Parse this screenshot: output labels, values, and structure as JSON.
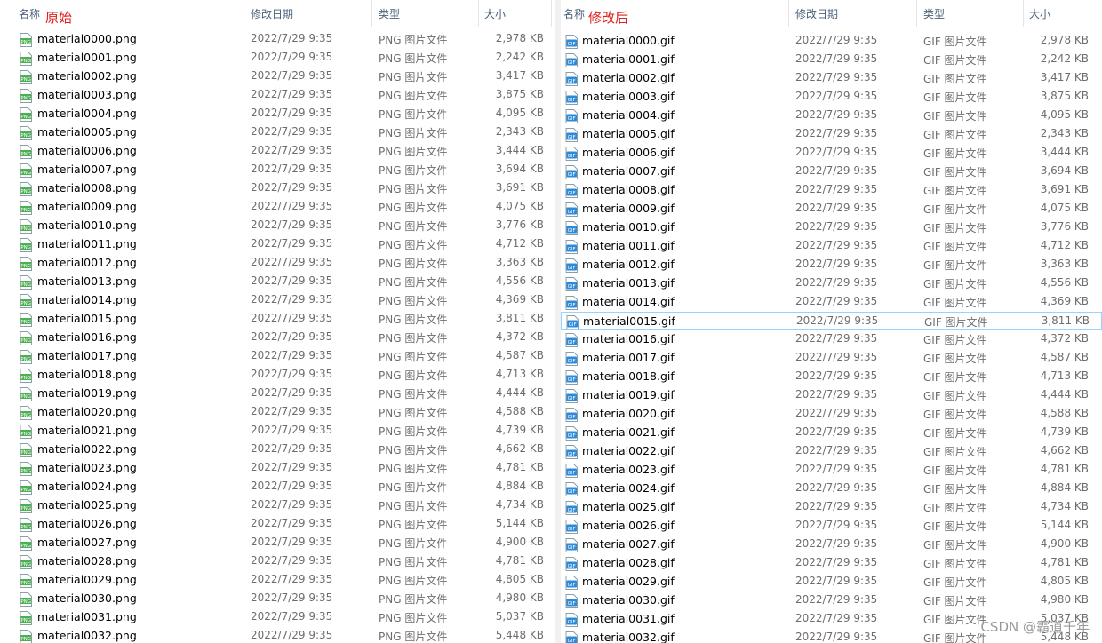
{
  "columns": {
    "name": "名称",
    "date": "修改日期",
    "type": "类型",
    "size": "大小"
  },
  "left": {
    "annotation": "原始",
    "type_label": "PNG 图片文件",
    "rows": [
      {
        "name": "material0000.png",
        "date": "2022/7/29 9:35",
        "size": "2,978 KB"
      },
      {
        "name": "material0001.png",
        "date": "2022/7/29 9:35",
        "size": "2,242 KB"
      },
      {
        "name": "material0002.png",
        "date": "2022/7/29 9:35",
        "size": "3,417 KB"
      },
      {
        "name": "material0003.png",
        "date": "2022/7/29 9:35",
        "size": "3,875 KB"
      },
      {
        "name": "material0004.png",
        "date": "2022/7/29 9:35",
        "size": "4,095 KB"
      },
      {
        "name": "material0005.png",
        "date": "2022/7/29 9:35",
        "size": "2,343 KB"
      },
      {
        "name": "material0006.png",
        "date": "2022/7/29 9:35",
        "size": "3,444 KB"
      },
      {
        "name": "material0007.png",
        "date": "2022/7/29 9:35",
        "size": "3,694 KB"
      },
      {
        "name": "material0008.png",
        "date": "2022/7/29 9:35",
        "size": "3,691 KB"
      },
      {
        "name": "material0009.png",
        "date": "2022/7/29 9:35",
        "size": "4,075 KB"
      },
      {
        "name": "material0010.png",
        "date": "2022/7/29 9:35",
        "size": "3,776 KB"
      },
      {
        "name": "material0011.png",
        "date": "2022/7/29 9:35",
        "size": "4,712 KB"
      },
      {
        "name": "material0012.png",
        "date": "2022/7/29 9:35",
        "size": "3,363 KB"
      },
      {
        "name": "material0013.png",
        "date": "2022/7/29 9:35",
        "size": "4,556 KB"
      },
      {
        "name": "material0014.png",
        "date": "2022/7/29 9:35",
        "size": "4,369 KB"
      },
      {
        "name": "material0015.png",
        "date": "2022/7/29 9:35",
        "size": "3,811 KB"
      },
      {
        "name": "material0016.png",
        "date": "2022/7/29 9:35",
        "size": "4,372 KB"
      },
      {
        "name": "material0017.png",
        "date": "2022/7/29 9:35",
        "size": "4,587 KB"
      },
      {
        "name": "material0018.png",
        "date": "2022/7/29 9:35",
        "size": "4,713 KB"
      },
      {
        "name": "material0019.png",
        "date": "2022/7/29 9:35",
        "size": "4,444 KB"
      },
      {
        "name": "material0020.png",
        "date": "2022/7/29 9:35",
        "size": "4,588 KB"
      },
      {
        "name": "material0021.png",
        "date": "2022/7/29 9:35",
        "size": "4,739 KB"
      },
      {
        "name": "material0022.png",
        "date": "2022/7/29 9:35",
        "size": "4,662 KB"
      },
      {
        "name": "material0023.png",
        "date": "2022/7/29 9:35",
        "size": "4,781 KB"
      },
      {
        "name": "material0024.png",
        "date": "2022/7/29 9:35",
        "size": "4,884 KB"
      },
      {
        "name": "material0025.png",
        "date": "2022/7/29 9:35",
        "size": "4,734 KB"
      },
      {
        "name": "material0026.png",
        "date": "2022/7/29 9:35",
        "size": "5,144 KB"
      },
      {
        "name": "material0027.png",
        "date": "2022/7/29 9:35",
        "size": "4,900 KB"
      },
      {
        "name": "material0028.png",
        "date": "2022/7/29 9:35",
        "size": "4,781 KB"
      },
      {
        "name": "material0029.png",
        "date": "2022/7/29 9:35",
        "size": "4,805 KB"
      },
      {
        "name": "material0030.png",
        "date": "2022/7/29 9:35",
        "size": "4,980 KB"
      },
      {
        "name": "material0031.png",
        "date": "2022/7/29 9:35",
        "size": "5,037 KB"
      },
      {
        "name": "material0032.png",
        "date": "2022/7/29 9:35",
        "size": "5,448 KB"
      }
    ]
  },
  "right": {
    "annotation": "修改后",
    "type_label": "GIF 图片文件",
    "selected_index": 15,
    "rows": [
      {
        "name": "material0000.gif",
        "date": "2022/7/29 9:35",
        "size": "2,978 KB"
      },
      {
        "name": "material0001.gif",
        "date": "2022/7/29 9:35",
        "size": "2,242 KB"
      },
      {
        "name": "material0002.gif",
        "date": "2022/7/29 9:35",
        "size": "3,417 KB"
      },
      {
        "name": "material0003.gif",
        "date": "2022/7/29 9:35",
        "size": "3,875 KB"
      },
      {
        "name": "material0004.gif",
        "date": "2022/7/29 9:35",
        "size": "4,095 KB"
      },
      {
        "name": "material0005.gif",
        "date": "2022/7/29 9:35",
        "size": "2,343 KB"
      },
      {
        "name": "material0006.gif",
        "date": "2022/7/29 9:35",
        "size": "3,444 KB"
      },
      {
        "name": "material0007.gif",
        "date": "2022/7/29 9:35",
        "size": "3,694 KB"
      },
      {
        "name": "material0008.gif",
        "date": "2022/7/29 9:35",
        "size": "3,691 KB"
      },
      {
        "name": "material0009.gif",
        "date": "2022/7/29 9:35",
        "size": "4,075 KB"
      },
      {
        "name": "material0010.gif",
        "date": "2022/7/29 9:35",
        "size": "3,776 KB"
      },
      {
        "name": "material0011.gif",
        "date": "2022/7/29 9:35",
        "size": "4,712 KB"
      },
      {
        "name": "material0012.gif",
        "date": "2022/7/29 9:35",
        "size": "3,363 KB"
      },
      {
        "name": "material0013.gif",
        "date": "2022/7/29 9:35",
        "size": "4,556 KB"
      },
      {
        "name": "material0014.gif",
        "date": "2022/7/29 9:35",
        "size": "4,369 KB"
      },
      {
        "name": "material0015.gif",
        "date": "2022/7/29 9:35",
        "size": "3,811 KB"
      },
      {
        "name": "material0016.gif",
        "date": "2022/7/29 9:35",
        "size": "4,372 KB"
      },
      {
        "name": "material0017.gif",
        "date": "2022/7/29 9:35",
        "size": "4,587 KB"
      },
      {
        "name": "material0018.gif",
        "date": "2022/7/29 9:35",
        "size": "4,713 KB"
      },
      {
        "name": "material0019.gif",
        "date": "2022/7/29 9:35",
        "size": "4,444 KB"
      },
      {
        "name": "material0020.gif",
        "date": "2022/7/29 9:35",
        "size": "4,588 KB"
      },
      {
        "name": "material0021.gif",
        "date": "2022/7/29 9:35",
        "size": "4,739 KB"
      },
      {
        "name": "material0022.gif",
        "date": "2022/7/29 9:35",
        "size": "4,662 KB"
      },
      {
        "name": "material0023.gif",
        "date": "2022/7/29 9:35",
        "size": "4,781 KB"
      },
      {
        "name": "material0024.gif",
        "date": "2022/7/29 9:35",
        "size": "4,884 KB"
      },
      {
        "name": "material0025.gif",
        "date": "2022/7/29 9:35",
        "size": "4,734 KB"
      },
      {
        "name": "material0026.gif",
        "date": "2022/7/29 9:35",
        "size": "5,144 KB"
      },
      {
        "name": "material0027.gif",
        "date": "2022/7/29 9:35",
        "size": "4,900 KB"
      },
      {
        "name": "material0028.gif",
        "date": "2022/7/29 9:35",
        "size": "4,781 KB"
      },
      {
        "name": "material0029.gif",
        "date": "2022/7/29 9:35",
        "size": "4,805 KB"
      },
      {
        "name": "material0030.gif",
        "date": "2022/7/29 9:35",
        "size": "4,980 KB"
      },
      {
        "name": "material0031.gif",
        "date": "2022/7/29 9:35",
        "size": "5,037 KB"
      },
      {
        "name": "material0032.gif",
        "date": "2022/7/29 9:35",
        "size": "5,448 KB"
      }
    ]
  },
  "watermark": "CSDN @霸道千年",
  "colors": {
    "annotation": "#e0201e",
    "png_icon": "#4caf50",
    "gif_icon": "#2d8ad8",
    "header_text": "#4c607a"
  },
  "icons": {
    "png": "png-file-icon",
    "gif": "gif-file-icon",
    "sort": "sort-up-icon"
  }
}
